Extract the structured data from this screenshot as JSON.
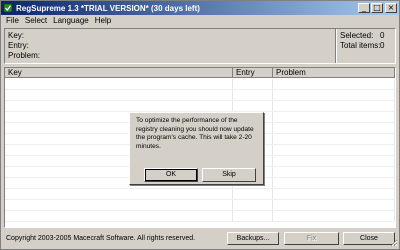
{
  "window": {
    "title": "RegSupreme 1.3 *TRIAL VERSION* (30 days left)",
    "minimize_glyph": "_",
    "maximize_glyph": "□",
    "close_glyph": "×"
  },
  "menu": [
    "File",
    "Select",
    "Language",
    "Help"
  ],
  "info": {
    "key_label": "Key:",
    "entry_label": "Entry:",
    "problem_label": "Problem:",
    "selected_label": "Selected:",
    "selected_value": "0",
    "total_label": "Total items:",
    "total_value": "0"
  },
  "list": {
    "columns": [
      "Key",
      "Entry",
      "Problem"
    ]
  },
  "dialog": {
    "message": "To optimize the performance of the registry cleaning you should now update the program's cache. This will take 2-20 minutes.",
    "ok_label": "OK",
    "skip_label": "Skip"
  },
  "footer": {
    "copyright": "Copyright 2003-2005 Macecraft Software. All rights reserved.",
    "backups_label": "Backups...",
    "fix_label": "Fix",
    "close_label": "Close"
  },
  "colors": {
    "titlebar_start": "#0a246a",
    "titlebar_end": "#a6caf0",
    "face": "#d4d0c8"
  }
}
